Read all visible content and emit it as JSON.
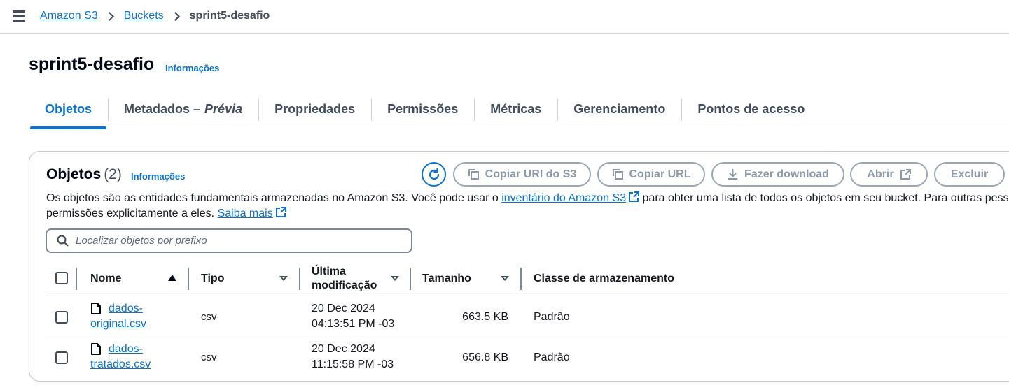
{
  "breadcrumb": {
    "items": [
      {
        "label": "Amazon S3"
      },
      {
        "label": "Buckets"
      }
    ],
    "current": "sprint5-desafio"
  },
  "header": {
    "title": "sprint5-desafio",
    "info_label": "Informações"
  },
  "tabs": [
    {
      "label": "Objetos",
      "active": true
    },
    {
      "label": "Metadados –",
      "suffix": "Prévia"
    },
    {
      "label": "Propriedades"
    },
    {
      "label": "Permissões"
    },
    {
      "label": "Métricas"
    },
    {
      "label": "Gerenciamento"
    },
    {
      "label": "Pontos de acesso"
    }
  ],
  "objects": {
    "title": "Objetos",
    "count": "(2)",
    "info_label": "Informações",
    "toolbar": {
      "copy_uri": "Copiar URI do S3",
      "copy_url": "Copiar URL",
      "download": "Fazer download",
      "open": "Abrir",
      "delete": "Excluir"
    },
    "description": {
      "part1": "Os objetos são as entidades fundamentais armazenadas no Amazon S3. Você pode usar o ",
      "link1": "inventário do Amazon S3",
      "part2": " para obter uma lista de todos os objetos em seu bucket. Para outras pessoa",
      "part3": "permissões explicitamente a eles. ",
      "link2": "Saiba mais"
    },
    "search": {
      "placeholder": "Localizar objetos por prefixo",
      "value": ""
    },
    "columns": {
      "name": "Nome",
      "type": "Tipo",
      "modified_line1": "Última",
      "modified_line2": "modificação",
      "size": "Tamanho",
      "storage_class": "Classe de armazenamento"
    },
    "rows": [
      {
        "name_line1": "dados-",
        "name_line2": "original.csv",
        "type": "csv",
        "date": "20 Dec 2024",
        "time": "04:13:51 PM -03",
        "size": "663.5 KB",
        "storage_class": "Padrão"
      },
      {
        "name_line1": "dados-",
        "name_line2": "tratados.csv",
        "type": "csv",
        "date": "20 Dec 2024",
        "time": "11:15:58 PM -03",
        "size": "656.8 KB",
        "storage_class": "Padrão"
      }
    ]
  },
  "colors": {
    "link": "#0972d3",
    "disabled_button": "#8d99a8",
    "border": "#c6c6cd"
  }
}
